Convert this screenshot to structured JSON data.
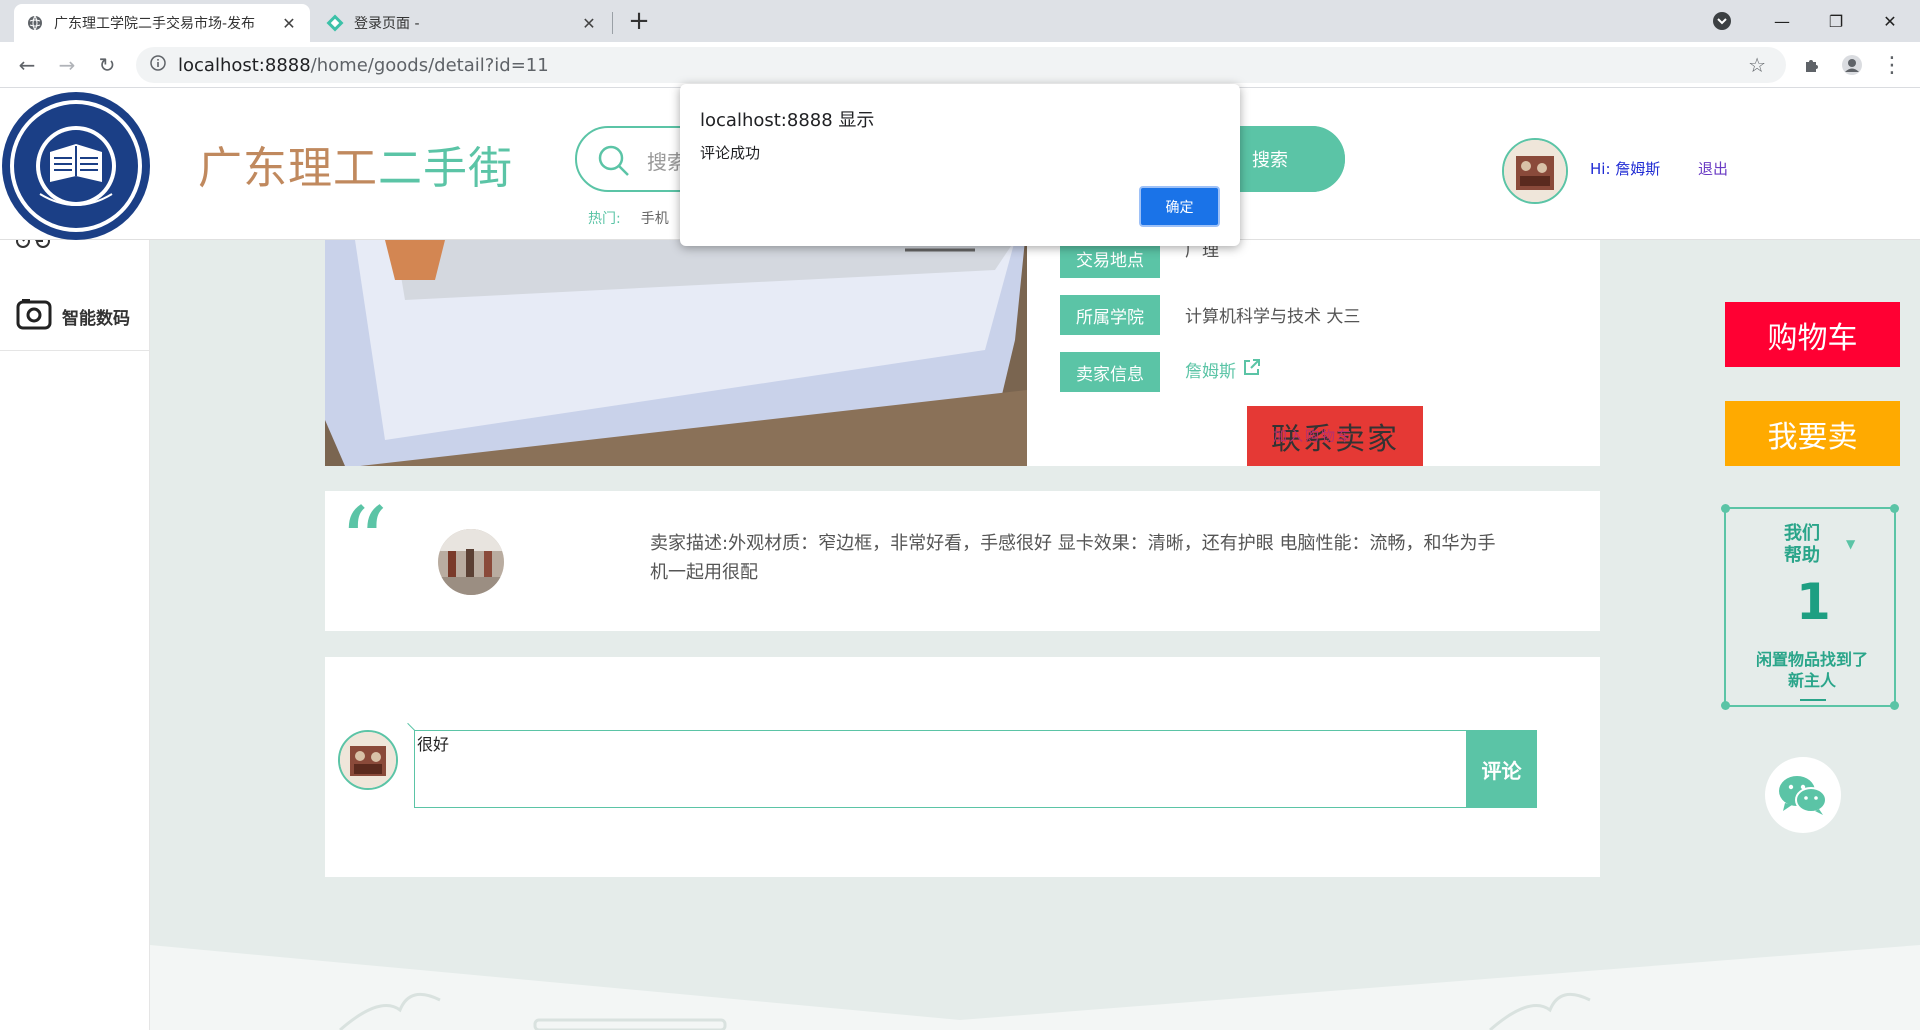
{
  "browser": {
    "tabs": [
      {
        "title": "广东理工学院二手交易市场-发布"
      },
      {
        "title": "登录页面 -"
      }
    ],
    "url_host": "localhost:8888",
    "url_path": "/home/goods/detail?id=11"
  },
  "header": {
    "title_part1": "广东理工",
    "title_part2": "二手街",
    "search_placeholder": "搜索",
    "search_button": "搜索",
    "hot_label": "热门:",
    "hot_items": [
      "手机"
    ],
    "greeting": "Hi: 詹姆斯",
    "logout": "退出"
  },
  "sidebar": {
    "items": [
      {
        "label": "智能数码",
        "icon": "camera-icon"
      }
    ]
  },
  "product": {
    "info": [
      {
        "tag": "交易地点",
        "value": "广理"
      },
      {
        "tag": "所属学院",
        "value": "计算机科学与技术 大三"
      },
      {
        "tag": "卖家信息",
        "value": "詹姆斯"
      }
    ],
    "contact_button": "联系卖家",
    "contact_overlay": "加入购物车"
  },
  "description": {
    "text": "卖家描述:外观材质：窄边框，非常好看，手感很好 显卡效果：清晰，还有护眼 电脑性能：流畅，和华为手机一起用很配"
  },
  "comment": {
    "input_value": "很好",
    "submit_label": "评论"
  },
  "right_panel": {
    "cart_label": "购物车",
    "sell_label": "我要卖",
    "help_line1": "我们",
    "help_line2": "帮助",
    "help_count": "1",
    "help_caption_1": "闲置物品找到了",
    "help_caption_2": "新主人"
  },
  "dialog": {
    "title": "localhost:8888 显示",
    "message": "评论成功",
    "ok_label": "确定"
  },
  "colors": {
    "accent": "#5bc4a6",
    "cart": "#ff0033",
    "sell": "#ffaa00",
    "contact": "#e53935"
  }
}
